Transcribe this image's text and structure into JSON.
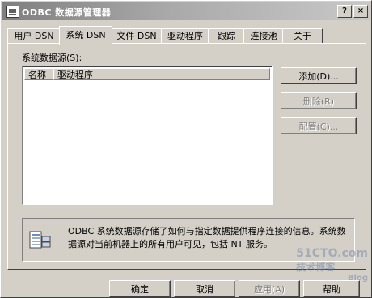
{
  "window": {
    "title": "ODBC 数据源管理器",
    "help_glyph": "?",
    "close_glyph": "×"
  },
  "tabs": [
    {
      "label": "用户 DSN",
      "active": false
    },
    {
      "label": "系统 DSN",
      "active": true
    },
    {
      "label": "文件 DSN",
      "active": false
    },
    {
      "label": "驱动程序",
      "active": false
    },
    {
      "label": "跟踪",
      "active": false
    },
    {
      "label": "连接池",
      "active": false
    },
    {
      "label": "关于",
      "active": false
    }
  ],
  "panel": {
    "section_label": "系统数据源(S):",
    "columns": [
      "名称",
      "驱动程序"
    ],
    "rows": []
  },
  "side_buttons": {
    "add": "添加(D)...",
    "remove": "删除(R)",
    "configure": "配置(C)..."
  },
  "info": {
    "text": "ODBC 系统数据源存储了如何与指定数据提供程序连接的信息。系统数据源对当前机器上的所有用户可见，包括 NT 服务。",
    "icon": "data-sources-icon"
  },
  "footer_buttons": {
    "ok": "确定",
    "cancel": "取消",
    "apply": "应用(A)",
    "help": "帮助"
  },
  "watermark": {
    "line1": "51CTO.com",
    "line2": "技术博客",
    "line3": "Blog"
  }
}
